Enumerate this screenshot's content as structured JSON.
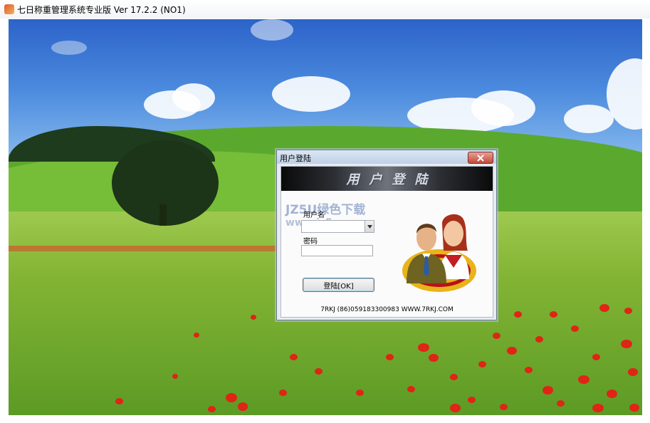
{
  "window": {
    "title": "七日称重管理系统专业版 Ver 17.2.2 (NO1)",
    "icon": "app-scale-icon"
  },
  "dialog": {
    "title": "用户登陆",
    "banner": "用户登陆",
    "username_label": "用户名",
    "username_value": "",
    "password_label": "密码",
    "password_value": "",
    "ok_button": "登陆[OK]",
    "footer": "7RKJ (86)059183300983 WWW.7RKJ.COM",
    "icon": "users-icon"
  },
  "watermark": {
    "line1": "JZ5U绿色下载",
    "line2": "www.jz5u.com"
  },
  "colors": {
    "sky": "#4c8bde",
    "grass": "#76b233",
    "poppy": "#e02415",
    "dialog_bg": "#e7ebf2",
    "close_button": "#c24a3a"
  }
}
